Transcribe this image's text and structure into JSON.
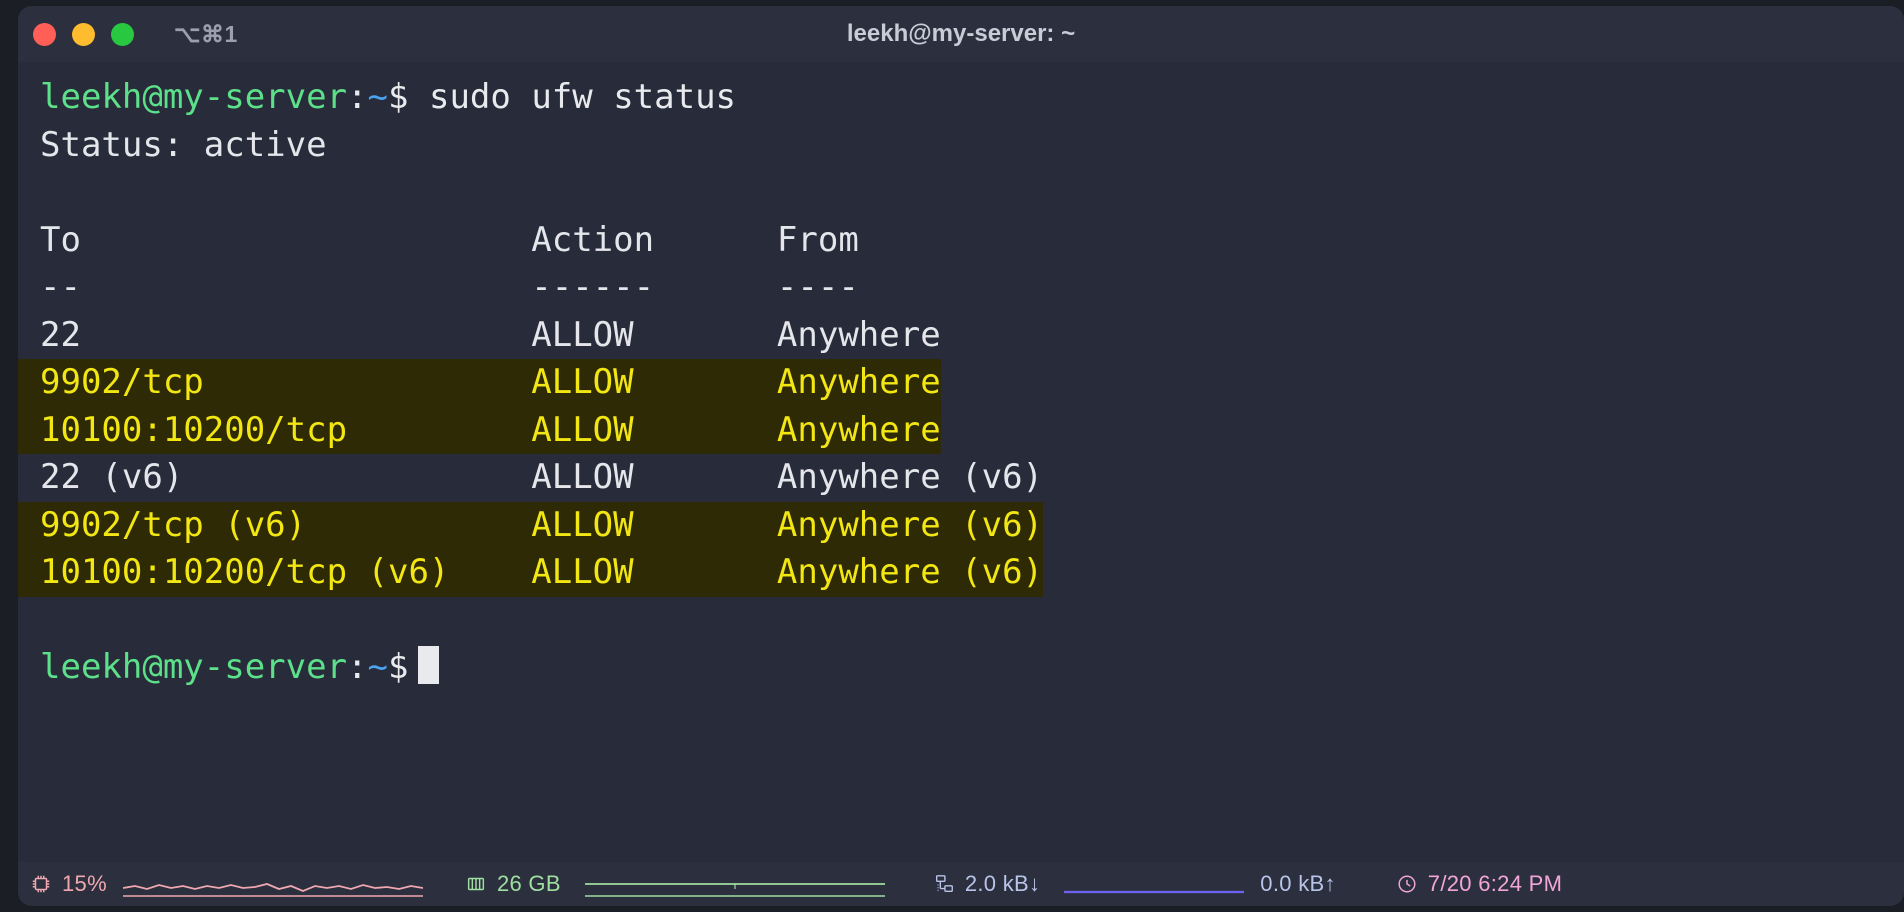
{
  "window": {
    "title": "leekh@my-server: ~",
    "shortcut": "⌥⌘1",
    "traffic_lights": [
      "close",
      "minimize",
      "zoom"
    ],
    "colors": {
      "background": "#282c3a",
      "titlebar": "#2b2f3e",
      "prompt_green": "#5ce08a",
      "prompt_blue": "#4aa3f0",
      "highlight_bg": "#2e2a05",
      "highlight_fg": "#f2e613",
      "text": "#e4e6eb"
    }
  },
  "terminal": {
    "prompt": {
      "user_host": "leekh@my-server",
      "colon": ":",
      "path": "~",
      "sigil": "$"
    },
    "command": " sudo ufw status",
    "status_line": "Status: active",
    "blank": " ",
    "table": {
      "headers": {
        "to": "To",
        "action": "Action",
        "from": "From"
      },
      "header_line": "To                      Action      From",
      "rule_line": "--                      ------      ----",
      "rows": [
        {
          "to": "22",
          "action": "ALLOW",
          "from": "Anywhere",
          "highlighted": false,
          "line": "22                      ALLOW       Anywhere"
        },
        {
          "to": "9902/tcp",
          "action": "ALLOW",
          "from": "Anywhere",
          "highlighted": true,
          "line": "9902/tcp                ALLOW       Anywhere"
        },
        {
          "to": "10100:10200/tcp",
          "action": "ALLOW",
          "from": "Anywhere",
          "highlighted": true,
          "line": "10100:10200/tcp         ALLOW       Anywhere"
        },
        {
          "to": "22 (v6)",
          "action": "ALLOW",
          "from": "Anywhere (v6)",
          "highlighted": false,
          "line": "22 (v6)                 ALLOW       Anywhere (v6)"
        },
        {
          "to": "9902/tcp (v6)",
          "action": "ALLOW",
          "from": "Anywhere (v6)",
          "highlighted": true,
          "line": "9902/tcp (v6)           ALLOW       Anywhere (v6)"
        },
        {
          "to": "10100:10200/tcp (v6)",
          "action": "ALLOW",
          "from": "Anywhere (v6)",
          "highlighted": true,
          "line": "10100:10200/tcp (v6)    ALLOW       Anywhere (v6)"
        }
      ]
    }
  },
  "statusbar": {
    "cpu": {
      "icon": "cpu-icon",
      "value": "15%"
    },
    "memory": {
      "icon": "ram-icon",
      "value": "26 GB"
    },
    "net_down": {
      "icon": "network-icon",
      "value": "2.0 kB↓"
    },
    "net_up": {
      "value": "0.0 kB↑"
    },
    "clock": {
      "icon": "clock-icon",
      "value": "7/20 6:24 PM"
    }
  }
}
